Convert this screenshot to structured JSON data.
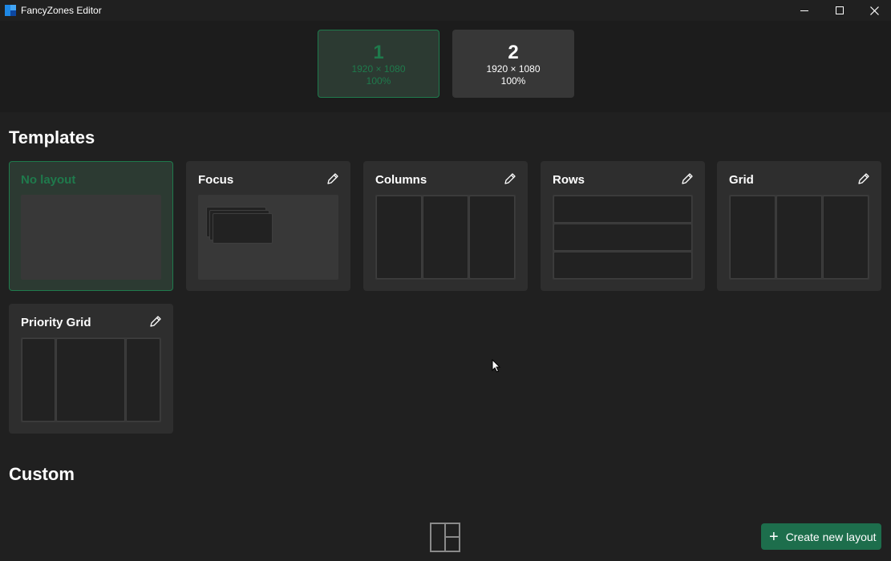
{
  "window": {
    "title": "FancyZones Editor"
  },
  "monitors": [
    {
      "number": "1",
      "resolution": "1920 × 1080",
      "scale": "100%",
      "selected": true
    },
    {
      "number": "2",
      "resolution": "1920 × 1080",
      "scale": "100%",
      "selected": false
    }
  ],
  "templates": {
    "heading": "Templates",
    "items": [
      {
        "name": "No layout"
      },
      {
        "name": "Focus"
      },
      {
        "name": "Columns"
      },
      {
        "name": "Rows"
      },
      {
        "name": "Grid"
      },
      {
        "name": "Priority Grid"
      }
    ]
  },
  "custom": {
    "heading": "Custom"
  },
  "actions": {
    "create_new_layout": "Create new layout"
  },
  "colors": {
    "accent": "#1f7a4c",
    "button": "#1d6e4c",
    "background": "#202020",
    "card": "#2e2e2e"
  }
}
